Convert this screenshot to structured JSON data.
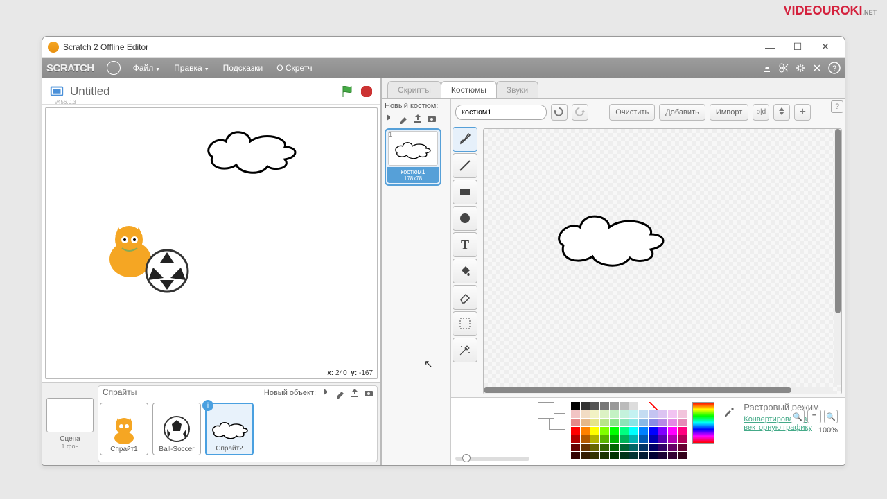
{
  "titlebar": {
    "title": "Scratch 2 Offline Editor"
  },
  "brand": "VIDEOUROKI",
  "brand_suffix": ".NET",
  "menubar": {
    "logo": "SCRATCH",
    "file": "Файл",
    "edit": "Правка",
    "tips": "Подсказки",
    "about": "О Скретч"
  },
  "stage": {
    "title": "Untitled",
    "version": "v456.0.3",
    "coords_x_label": "x:",
    "coords_x": "240",
    "coords_y_label": "y:",
    "coords_y": "-167"
  },
  "sprite_panel": {
    "scene_label": "Сцена",
    "scene_sub": "1 фон",
    "sprites_label": "Спрайты",
    "new_object_label": "Новый объект:",
    "sprites": [
      {
        "name": "Спрайт1"
      },
      {
        "name": "Ball-Soccer"
      },
      {
        "name": "Спрайт2"
      }
    ]
  },
  "tabs": {
    "scripts": "Скрипты",
    "costumes": "Костюмы",
    "sounds": "Звуки"
  },
  "costume_editor": {
    "new_costume": "Новый костюм:",
    "name": "костюм1",
    "name_label": "костюм1",
    "size": "178x78",
    "thumb_num": "1",
    "clear": "Очистить",
    "add": "Добавить",
    "import": "Импорт",
    "zoom": "100%",
    "mode_label": "Растровый режим",
    "convert_label": "Конвертировать в векторную графику"
  },
  "palette": {
    "grays": [
      "#000",
      "#333",
      "#555",
      "#777",
      "#999",
      "#bbb",
      "#ddd",
      "#fff"
    ],
    "rows": [
      [
        "#f2c4c4",
        "#f2dcc4",
        "#f2f2c4",
        "#dcf2c4",
        "#c4f2c4",
        "#c4f2dc",
        "#c4f2f2",
        "#c4dcf2",
        "#c4c4f2",
        "#dcc4f2",
        "#f2c4f2",
        "#f2c4dc"
      ],
      [
        "#e58a8a",
        "#e5b88a",
        "#e5e58a",
        "#b8e58a",
        "#8ae58a",
        "#8ae5b8",
        "#8ae5e5",
        "#8ab8e5",
        "#8a8ae5",
        "#b88ae5",
        "#e58ae5",
        "#e58ab8"
      ],
      [
        "#ff0000",
        "#ff8000",
        "#ffff00",
        "#80ff00",
        "#00ff00",
        "#00ff80",
        "#00ffff",
        "#0080ff",
        "#0000ff",
        "#8000ff",
        "#ff00ff",
        "#ff0080"
      ],
      [
        "#b30000",
        "#b35900",
        "#b3b300",
        "#59b300",
        "#00b300",
        "#00b359",
        "#00b3b3",
        "#0059b3",
        "#0000b3",
        "#5900b3",
        "#b300b3",
        "#b30059"
      ],
      [
        "#660000",
        "#663300",
        "#666600",
        "#336600",
        "#006600",
        "#006633",
        "#006666",
        "#003366",
        "#000066",
        "#330066",
        "#660066",
        "#660033"
      ],
      [
        "#330000",
        "#331a00",
        "#333300",
        "#1a3300",
        "#003300",
        "#00331a",
        "#003333",
        "#001a33",
        "#000033",
        "#1a0033",
        "#330033",
        "#33001a"
      ]
    ]
  }
}
